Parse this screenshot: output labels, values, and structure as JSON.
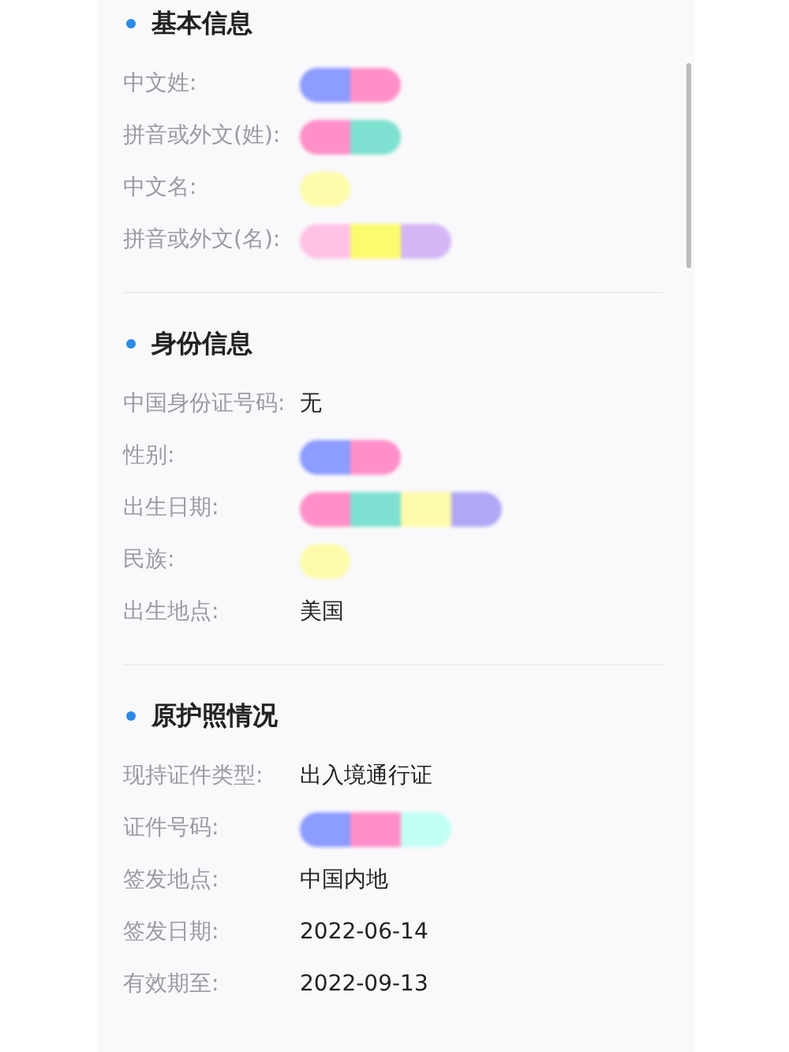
{
  "sections": [
    {
      "title": "基本信息",
      "fields": [
        {
          "label": "中文姓:",
          "mask": [
            {
              "color": "#8c9cff"
            },
            {
              "color": "#ff8fc8"
            }
          ]
        },
        {
          "label": "拼音或外文(姓):",
          "mask": [
            {
              "color": "#ff8fc8"
            },
            {
              "color": "#7ee0d0"
            }
          ]
        },
        {
          "label": "中文名:",
          "mask": [
            {
              "color": "#fdfbaa"
            }
          ]
        },
        {
          "label": "拼音或外文(名):",
          "mask": [
            {
              "color": "#ffc2e6"
            },
            {
              "color": "#fbfb6e"
            },
            {
              "color": "#d4b5f5"
            }
          ]
        }
      ]
    },
    {
      "title": "身份信息",
      "fields": [
        {
          "label": "中国身份证号码:",
          "value": "无"
        },
        {
          "label": "性别:",
          "mask": [
            {
              "color": "#8c9cff"
            },
            {
              "color": "#ff8fc8"
            }
          ]
        },
        {
          "label": "出生日期:",
          "mask": [
            {
              "color": "#ff8fc8"
            },
            {
              "color": "#7ee0d0"
            },
            {
              "color": "#fdfbaa"
            },
            {
              "color": "#b0a8f5"
            }
          ]
        },
        {
          "label": "民族:",
          "mask": [
            {
              "color": "#fdfbaa"
            }
          ]
        },
        {
          "label": "出生地点:",
          "value": "美国"
        }
      ]
    },
    {
      "title": "原护照情况",
      "fields": [
        {
          "label": "现持证件类型:",
          "value": "出入境通行证"
        },
        {
          "label": "证件号码:",
          "mask": [
            {
              "color": "#8c9cff"
            },
            {
              "color": "#ff8fc8"
            },
            {
              "color": "#c2fff4"
            }
          ]
        },
        {
          "label": "签发地点:",
          "value": "中国内地"
        },
        {
          "label": "签发日期:",
          "value": "2022-06-14"
        },
        {
          "label": "有效期至:",
          "value": "2022-09-13"
        }
      ]
    }
  ]
}
